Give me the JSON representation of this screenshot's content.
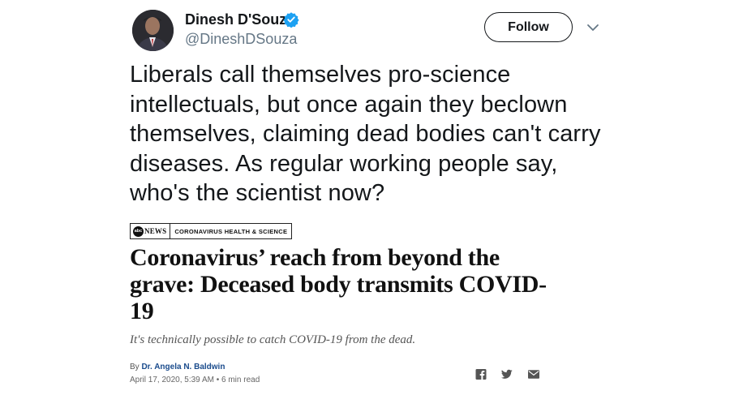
{
  "tweet": {
    "author_name": "Dinesh D'Souza",
    "author_handle": "@DineshDSouza",
    "follow_label": "Follow",
    "text": "Liberals call themselves pro-science intellectuals, but once again they beclown themselves, claiming dead bodies can't carry diseases. As regular working people say, who's the scientist now?",
    "icons": {
      "verified": "verified-badge-icon",
      "menu": "chevron-down-icon"
    },
    "colors": {
      "verified": "#1da1f2",
      "handle": "#657786"
    }
  },
  "article": {
    "source_logo": "abc NEWS",
    "source_logo_mark": "abc",
    "source_logo_word": "NEWS",
    "section": "CORONAVIRUS HEALTH & SCIENCE",
    "headline": "Coronavirus’ reach from beyond the grave: Deceased body transmits COVID-19",
    "dek": "It's technically possible to catch COVID-19 from the dead.",
    "byline_prefix": "By",
    "byline_author": "Dr. Angela N. Baldwin",
    "dateline": "April 17, 2020, 5:39 AM • 6 min read",
    "share_icons": [
      "facebook-icon",
      "twitter-icon",
      "email-icon"
    ],
    "colors": {
      "author": "#1a4b8c"
    }
  }
}
